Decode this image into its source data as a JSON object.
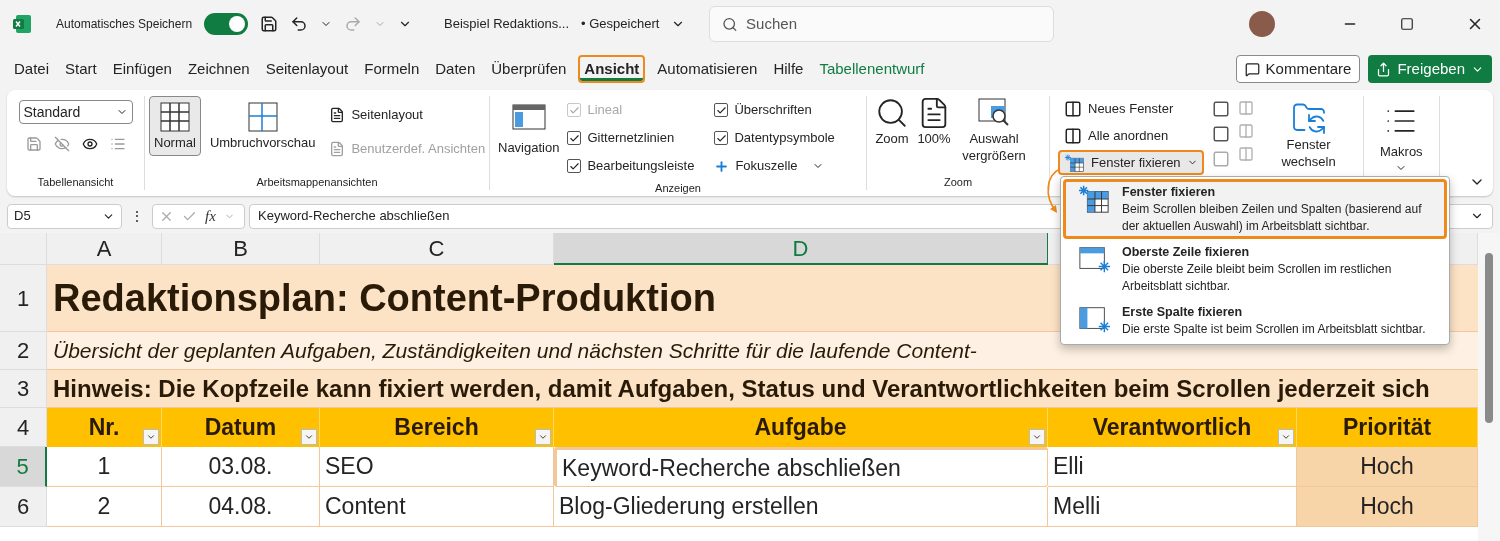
{
  "title_bar": {
    "autosave": {
      "label": "Automatisches Speichern",
      "on": true
    },
    "document_title": "Beispiel Redaktions...",
    "save_status": "• Gespeichert",
    "search": {
      "placeholder": "Suchen"
    }
  },
  "menu_tabs": [
    {
      "label": "Datei",
      "selected": false,
      "contextual": false
    },
    {
      "label": "Start",
      "selected": false,
      "contextual": false
    },
    {
      "label": "Einfügen",
      "selected": false,
      "contextual": false
    },
    {
      "label": "Zeichnen",
      "selected": false,
      "contextual": false
    },
    {
      "label": "Seitenlayout",
      "selected": false,
      "contextual": false
    },
    {
      "label": "Formeln",
      "selected": false,
      "contextual": false
    },
    {
      "label": "Daten",
      "selected": false,
      "contextual": false
    },
    {
      "label": "Überprüfen",
      "selected": false,
      "contextual": false
    },
    {
      "label": "Ansicht",
      "selected": true,
      "contextual": false
    },
    {
      "label": "Automatisieren",
      "selected": false,
      "contextual": false
    },
    {
      "label": "Hilfe",
      "selected": false,
      "contextual": false
    },
    {
      "label": "Tabellenentwurf",
      "selected": false,
      "contextual": true
    }
  ],
  "header_buttons": {
    "comments": "Kommentare",
    "share": "Freigeben"
  },
  "ribbon": {
    "sheet_view": {
      "label": "Tabellenansicht",
      "select": "Standard"
    },
    "workbook_views": {
      "label": "Arbeitsmappenansichten",
      "items": [
        {
          "label": "Normal",
          "selected": true,
          "disabled": false
        },
        {
          "label": "Umbruchvorschau",
          "selected": false,
          "disabled": false
        },
        {
          "label": "Seitenlayout",
          "selected": false,
          "disabled": false
        },
        {
          "label": "Benutzerdef. Ansichten",
          "selected": false,
          "disabled": true
        }
      ]
    },
    "show": {
      "label": "Anzeigen",
      "navigation": "Navigation",
      "checkboxes": [
        {
          "label": "Lineal",
          "checked": true,
          "disabled": true
        },
        {
          "label": "Gitternetzlinien",
          "checked": true,
          "disabled": false
        },
        {
          "label": "Bearbeitungsleiste",
          "checked": true,
          "disabled": false
        },
        {
          "label": "Überschriften",
          "checked": true,
          "disabled": false
        },
        {
          "label": "Datentypsymbole",
          "checked": true,
          "disabled": false
        }
      ],
      "focus_cell": "Fokuszelle"
    },
    "zoom": {
      "label": "Zoom",
      "items": [
        "Zoom",
        "100%",
        "Auswahl vergrößern"
      ]
    },
    "window": {
      "items": [
        {
          "label": "Neues Fenster",
          "highlighted": false
        },
        {
          "label": "Alle anordnen",
          "highlighted": false
        },
        {
          "label": "Fenster fixieren",
          "highlighted": true
        }
      ],
      "switch": "Fenster wechseln"
    },
    "macros": {
      "label": "Makros"
    }
  },
  "formula_bar": {
    "name_box": "D5",
    "more": "⋮",
    "function_label": "fx",
    "formula": "Keyword-Recherche abschließen"
  },
  "sheet": {
    "columns": [
      {
        "label": "A",
        "selected": false
      },
      {
        "label": "B",
        "selected": false
      },
      {
        "label": "C",
        "selected": false
      },
      {
        "label": "D",
        "selected": true
      }
    ],
    "title_row": {
      "number": "1",
      "text": "Redaktionsplan: Content-Produktion"
    },
    "subtitle_row": {
      "number": "2",
      "text": "Übersicht der geplanten Aufgaben, Zuständigkeiten und nächsten Schritte für die laufende Content-"
    },
    "note_row": {
      "number": "3",
      "text": "Hinweis: Die Kopfzeile kann fixiert werden, damit Aufgaben, Status und Verantwortlichkeiten beim Scrollen jederzeit sich"
    },
    "header_row": {
      "number": "4",
      "cells": [
        {
          "label": "Nr.",
          "filter": true
        },
        {
          "label": "Datum",
          "filter": true
        },
        {
          "label": "Bereich",
          "filter": true
        },
        {
          "label": "Aufgabe",
          "filter": true
        },
        {
          "label": "Verantwortlich",
          "filter": true
        },
        {
          "label": "Priorität",
          "filter": false
        }
      ]
    },
    "rows": [
      {
        "number": "5",
        "selected": true,
        "cells": [
          "1",
          "03.08.",
          "SEO",
          "Keyword-Recherche abschließen",
          "Elli",
          "Hoch"
        ]
      },
      {
        "number": "6",
        "selected": false,
        "cells": [
          "2",
          "04.08.",
          "Content",
          "Blog-Gliederung erstellen",
          "Melli",
          "Hoch"
        ]
      }
    ]
  },
  "freeze_menu": {
    "items": [
      {
        "kind": "panes",
        "title": "Fenster fixieren",
        "description": "Beim Scrollen bleiben Zeilen und Spalten (basierend auf der aktuellen Auswahl) im Arbeitsblatt sichtbar.",
        "highlighted": true
      },
      {
        "kind": "top_row",
        "title": "Oberste Zeile fixieren",
        "description": "Die oberste Zeile bleibt beim Scrollen im restlichen Arbeitsblatt sichtbar.",
        "highlighted": false
      },
      {
        "kind": "first_column",
        "title": "Erste Spalte fixieren",
        "description": "Die erste Spalte ist beim Scrollen im Arbeitsblatt sichtbar.",
        "highlighted": false
      }
    ]
  }
}
